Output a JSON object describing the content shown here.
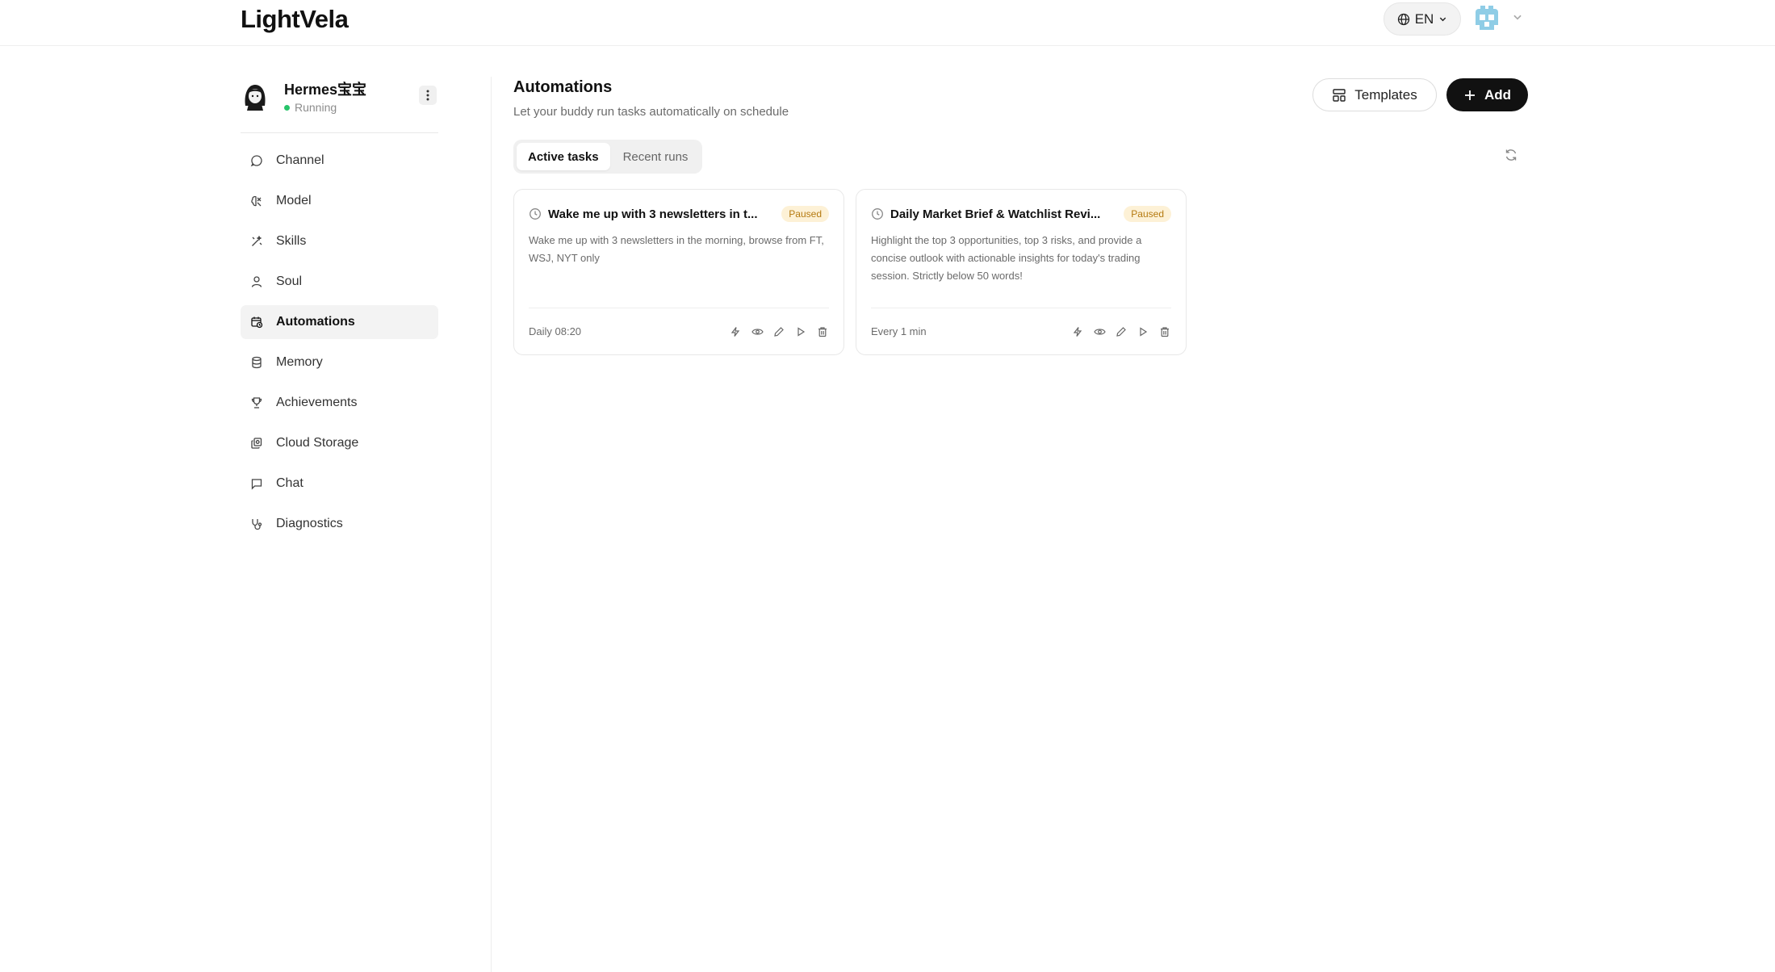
{
  "header": {
    "logo": "LightVela",
    "language": "EN"
  },
  "sidebar": {
    "bot": {
      "name": "Hermes宝宝",
      "status": "Running",
      "status_color": "#27c46a"
    },
    "items": [
      {
        "label": "Channel",
        "icon": "chat-bubble-icon"
      },
      {
        "label": "Model",
        "icon": "brain-icon"
      },
      {
        "label": "Skills",
        "icon": "magic-wand-icon"
      },
      {
        "label": "Soul",
        "icon": "person-icon"
      },
      {
        "label": "Automations",
        "icon": "calendar-clock-icon",
        "active": true
      },
      {
        "label": "Memory",
        "icon": "database-icon"
      },
      {
        "label": "Achievements",
        "icon": "trophy-icon"
      },
      {
        "label": "Cloud Storage",
        "icon": "cloud-storage-icon"
      },
      {
        "label": "Chat",
        "icon": "message-square-icon"
      },
      {
        "label": "Diagnostics",
        "icon": "stethoscope-icon"
      }
    ]
  },
  "main": {
    "title": "Automations",
    "subtitle": "Let your buddy run tasks automatically on schedule",
    "templates_label": "Templates",
    "add_label": "Add",
    "tabs": [
      {
        "label": "Active tasks",
        "active": true
      },
      {
        "label": "Recent runs",
        "active": false
      }
    ],
    "cards": [
      {
        "title": "Wake me up with 3 newsletters in t...",
        "status": "Paused",
        "description": "Wake me up with 3 newsletters in the morning, browse from FT, WSJ, NYT only",
        "schedule": "Daily 08:20"
      },
      {
        "title": "Daily Market Brief & Watchlist Revi...",
        "status": "Paused",
        "description": "Highlight the top 3 opportunities, top 3 risks, and provide a concise outlook with actionable insights for today's trading session. Strictly below 50 words!",
        "schedule": "Every 1 min"
      }
    ]
  },
  "colors": {
    "accent": "#111111",
    "paused_text": "#b57a10",
    "paused_bg": "#fdf1d6"
  }
}
